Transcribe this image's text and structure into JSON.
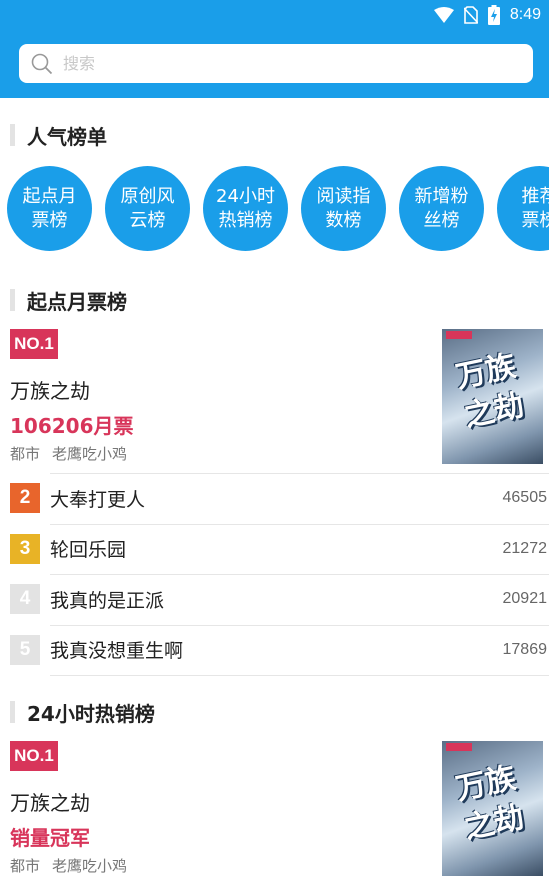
{
  "status": {
    "time": "8:49"
  },
  "search": {
    "placeholder": "搜索"
  },
  "popular": {
    "title": "人气榜单",
    "items": [
      {
        "line1": "起点月",
        "line2": "票榜"
      },
      {
        "line1": "原创风",
        "line2": "云榜"
      },
      {
        "line1": "24小时",
        "line2": "热销榜"
      },
      {
        "line1": "阅读指",
        "line2": "数榜"
      },
      {
        "line1": "新增粉",
        "line2": "丝榜"
      },
      {
        "line1": "推荐",
        "line2": "票榜"
      }
    ]
  },
  "monthly": {
    "title": "起点月票榜",
    "top": {
      "badge": "NO.1",
      "book_title": "万族之劫",
      "highlight": "106206月票",
      "category": "都市",
      "author": "老鹰吃小鸡",
      "cover_title": "万族之劫"
    },
    "rows": [
      {
        "rank": "2",
        "title": "大奉打更人",
        "count": "46505",
        "color": "#e8652c"
      },
      {
        "rank": "3",
        "title": "轮回乐园",
        "count": "21272",
        "color": "#e8b326"
      },
      {
        "rank": "4",
        "title": "我真的是正派",
        "count": "20921",
        "color": "#e3e3e3"
      },
      {
        "rank": "5",
        "title": "我真没想重生啊",
        "count": "17869",
        "color": "#e3e3e3"
      }
    ]
  },
  "hot24": {
    "title": "24小时热销榜",
    "top": {
      "badge": "NO.1",
      "book_title": "万族之劫",
      "highlight": "销量冠军",
      "category": "都市",
      "author": "老鹰吃小鸡",
      "cover_title": "万族之劫"
    }
  },
  "colors": {
    "primary": "#1a9ee9",
    "accent": "#d8355a"
  }
}
